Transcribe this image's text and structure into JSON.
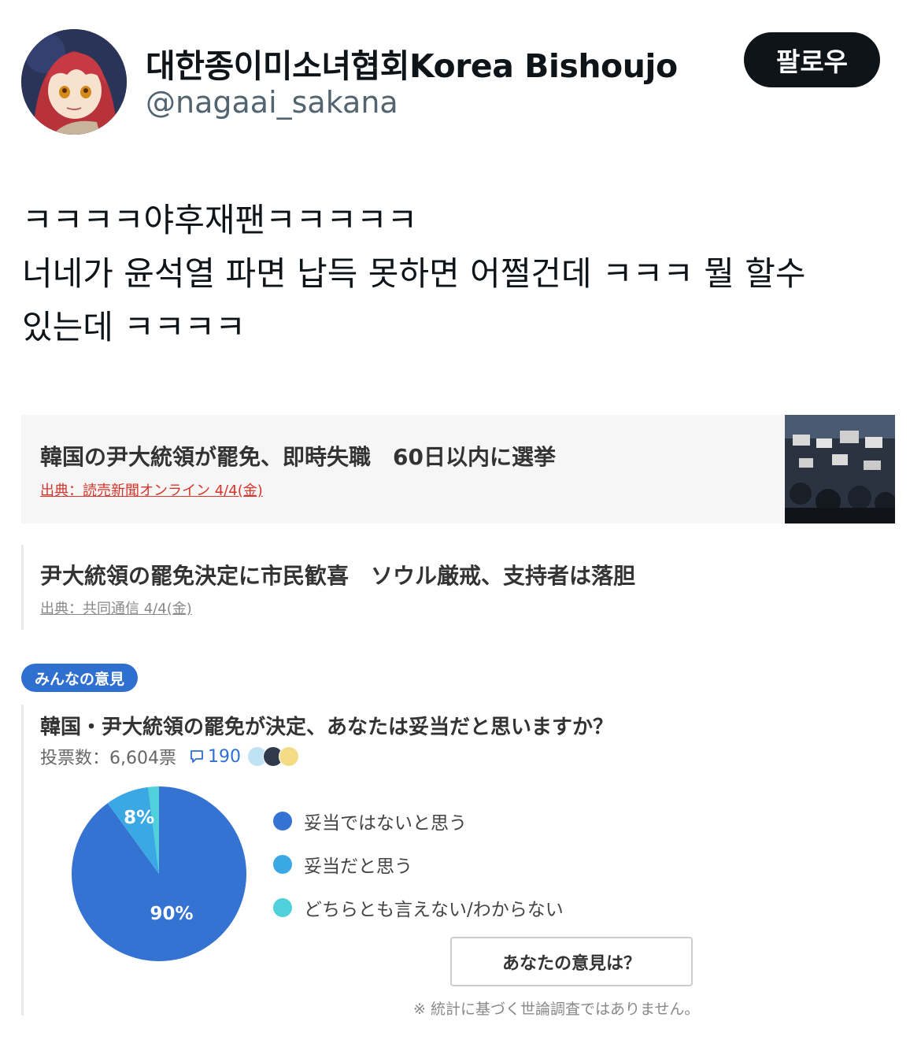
{
  "header": {
    "display_name": "대한종이미소녀협회Korea Bishoujo",
    "handle": "@nagaai_sakana",
    "follow_label": "팔로우"
  },
  "tweet": {
    "lines": [
      "ㅋㅋㅋㅋ야후재팬ㅋㅋㅋㅋㅋ",
      "너네가 윤석열 파면 납득 못하면 어쩔건데 ㅋㅋㅋ 뭘 할수",
      "있는데 ㅋㅋㅋㅋ"
    ]
  },
  "articles": [
    {
      "headline": "韓国の尹大統領が罷免、即時失職　60日以内に選挙",
      "source": "出典：読売新聞オンライン 4/4(金)",
      "source_color": "#d8342a"
    },
    {
      "headline": "尹大統領の罷免決定に市民歓喜　ソウル厳戒、支持者は落胆",
      "source": "出典：共同通信 4/4(金)",
      "source_color": "#888888"
    }
  ],
  "poll": {
    "badge": "みんなの意見",
    "question": "韓国・尹大統領の罷免が決定、あなたは妥当だと思いますか？",
    "votes_label": "投票数：6,604票",
    "comment_count": "190",
    "legend": [
      {
        "label": "妥当ではないと思う",
        "color": "#3573d3"
      },
      {
        "label": "妥当だと思う",
        "color": "#3aa9e3"
      },
      {
        "label": "どちらとも言えない/わからない",
        "color": "#4fd0da"
      }
    ],
    "opinion_button": "あなたの意見は？",
    "disclaimer": "※ 統計に基づく世論調査ではありません。"
  },
  "chart_data": {
    "type": "pie",
    "slices": [
      {
        "name": "妥当ではないと思う",
        "value": 90,
        "color": "#3573d3"
      },
      {
        "name": "妥当だと思う",
        "value": 8,
        "color": "#3aa9e3"
      },
      {
        "name": "どちらとも言えない/わからない",
        "value": 2,
        "color": "#4fd0da"
      }
    ],
    "data_labels": [
      "90%",
      "8%",
      ""
    ],
    "legend_position": "right"
  }
}
